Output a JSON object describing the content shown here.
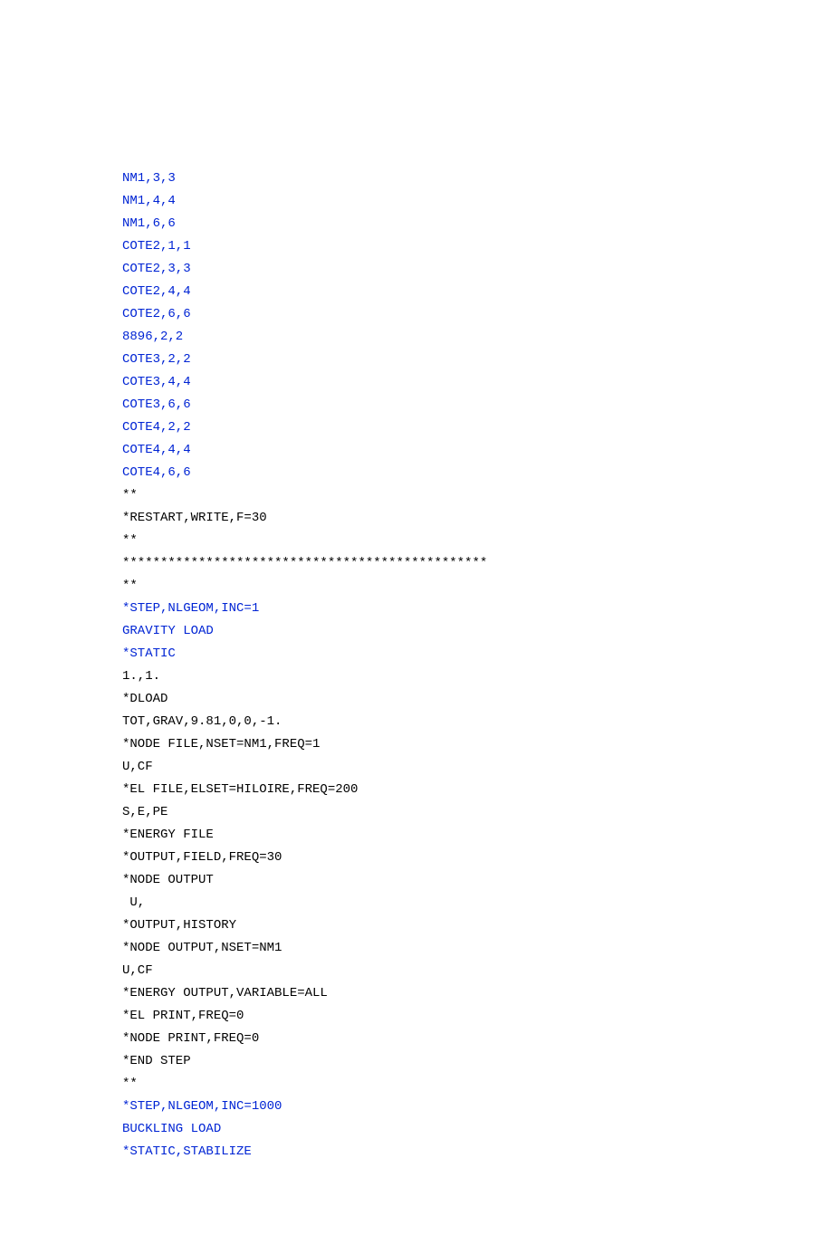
{
  "lines": [
    {
      "text": "NM1,3,3",
      "color": "blue"
    },
    {
      "text": "NM1,4,4",
      "color": "blue"
    },
    {
      "text": "NM1,6,6",
      "color": "blue"
    },
    {
      "text": "COTE2,1,1",
      "color": "blue"
    },
    {
      "text": "COTE2,3,3",
      "color": "blue"
    },
    {
      "text": "COTE2,4,4",
      "color": "blue"
    },
    {
      "text": "COTE2,6,6",
      "color": "blue"
    },
    {
      "text": "8896,2,2",
      "color": "blue"
    },
    {
      "text": "COTE3,2,2",
      "color": "blue"
    },
    {
      "text": "COTE3,4,4",
      "color": "blue"
    },
    {
      "text": "COTE3,6,6",
      "color": "blue"
    },
    {
      "text": "COTE4,2,2",
      "color": "blue"
    },
    {
      "text": "COTE4,4,4",
      "color": "blue"
    },
    {
      "text": "COTE4,6,6",
      "color": "blue"
    },
    {
      "text": "**",
      "color": "black"
    },
    {
      "text": "*RESTART,WRITE,F=30",
      "color": "black"
    },
    {
      "text": "**",
      "color": "black"
    },
    {
      "text": "************************************************",
      "color": "black"
    },
    {
      "text": "**",
      "color": "black"
    },
    {
      "text": "*STEP,NLGEOM,INC=1",
      "color": "blue"
    },
    {
      "text": "GRAVITY LOAD",
      "color": "blue"
    },
    {
      "text": "*STATIC",
      "color": "blue"
    },
    {
      "text": "1.,1.",
      "color": "black"
    },
    {
      "text": "*DLOAD",
      "color": "black"
    },
    {
      "text": "TOT,GRAV,9.81,0,0,-1.",
      "color": "black"
    },
    {
      "text": "*NODE FILE,NSET=NM1,FREQ=1",
      "color": "black"
    },
    {
      "text": "U,CF",
      "color": "black"
    },
    {
      "text": "*EL FILE,ELSET=HILOIRE,FREQ=200",
      "color": "black"
    },
    {
      "text": "S,E,PE",
      "color": "black"
    },
    {
      "text": "*ENERGY FILE",
      "color": "black"
    },
    {
      "text": "*OUTPUT,FIELD,FREQ=30",
      "color": "black"
    },
    {
      "text": "*NODE OUTPUT",
      "color": "black"
    },
    {
      "text": " U,",
      "color": "black"
    },
    {
      "text": "*OUTPUT,HISTORY",
      "color": "black"
    },
    {
      "text": "*NODE OUTPUT,NSET=NM1",
      "color": "black"
    },
    {
      "text": "U,CF",
      "color": "black"
    },
    {
      "text": "*ENERGY OUTPUT,VARIABLE=ALL",
      "color": "black"
    },
    {
      "text": "*EL PRINT,FREQ=0",
      "color": "black"
    },
    {
      "text": "*NODE PRINT,FREQ=0",
      "color": "black"
    },
    {
      "text": "*END STEP",
      "color": "black"
    },
    {
      "text": "**",
      "color": "black"
    },
    {
      "text": "*STEP,NLGEOM,INC=1000",
      "color": "blue"
    },
    {
      "text": "BUCKLING LOAD",
      "color": "blue"
    },
    {
      "text": "*STATIC,STABILIZE",
      "color": "blue"
    }
  ]
}
